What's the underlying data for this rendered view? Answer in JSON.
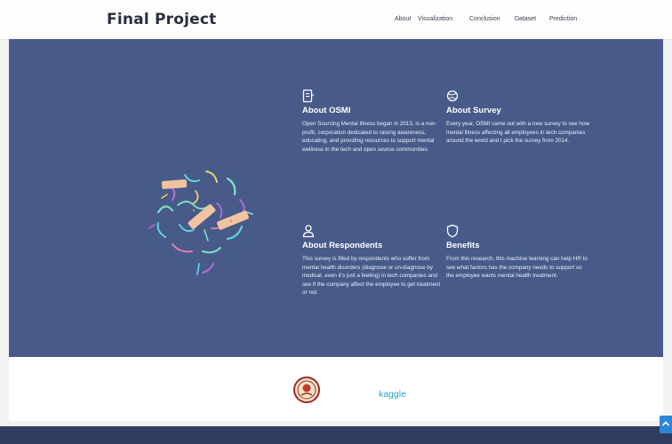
{
  "header": {
    "brand": "Final Project",
    "nav": [
      "About",
      "Visualization",
      "Conclusion",
      "Dataset",
      "Prediction"
    ]
  },
  "cards": [
    {
      "icon": "document-icon",
      "title": "About OSMI",
      "text": "Open Sourcing Mental Illness began in 2013, is a non-profit, corporation dedicated to raising awareness, educating, and providing resources to support mental wellness in the tech and open source communities."
    },
    {
      "icon": "globe-icon",
      "title": "About Survey",
      "text": "Every year, OSMI came out with a new survey to see how mental illness affecting all employees in tech companies around the world and I pick the survey from 2014."
    },
    {
      "icon": "user-icon",
      "title": "About Respondents",
      "text": "This survey is filled by respondents who suffer from mental health disorders (diagnose or un-diagnose by medical, even it's just a feeling) in tech companies and see if the company affect the employee to get treatment or not."
    },
    {
      "icon": "shield-icon",
      "title": "Benefits",
      "text": "From this research, this machine learning can help HR to see what factors has the company needs to support so the employee wants mental health treatment."
    }
  ],
  "logos": {
    "kaggle": "kaggle"
  },
  "colors": {
    "hero": "#475a89",
    "footer": "#2f3d61",
    "accent": "#2e86d8"
  }
}
